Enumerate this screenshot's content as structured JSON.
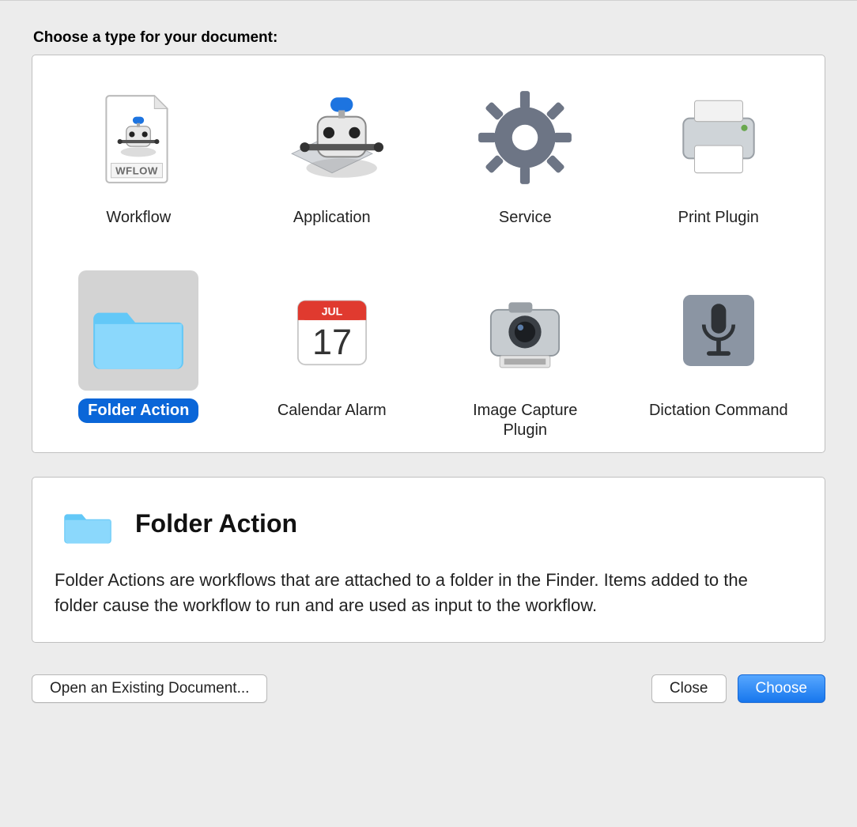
{
  "prompt": "Choose a type for your document:",
  "types": [
    {
      "id": "workflow",
      "label": "Workflow",
      "selected": false
    },
    {
      "id": "application",
      "label": "Application",
      "selected": false
    },
    {
      "id": "service",
      "label": "Service",
      "selected": false
    },
    {
      "id": "print-plugin",
      "label": "Print Plugin",
      "selected": false
    },
    {
      "id": "folder-action",
      "label": "Folder Action",
      "selected": true
    },
    {
      "id": "calendar-alarm",
      "label": "Calendar Alarm",
      "selected": false
    },
    {
      "id": "image-capture",
      "label": "Image Capture Plugin",
      "selected": false
    },
    {
      "id": "dictation",
      "label": "Dictation Command",
      "selected": false
    }
  ],
  "calendar": {
    "month": "JUL",
    "day": "17"
  },
  "workflow_badge": "WFLOW",
  "detail": {
    "title": "Folder Action",
    "description": "Folder Actions are workflows that are attached to a folder in the Finder. Items added to the folder cause the workflow to run and are used as input to the workflow."
  },
  "buttons": {
    "open_existing": "Open an Existing Document...",
    "close": "Close",
    "choose": "Choose"
  }
}
